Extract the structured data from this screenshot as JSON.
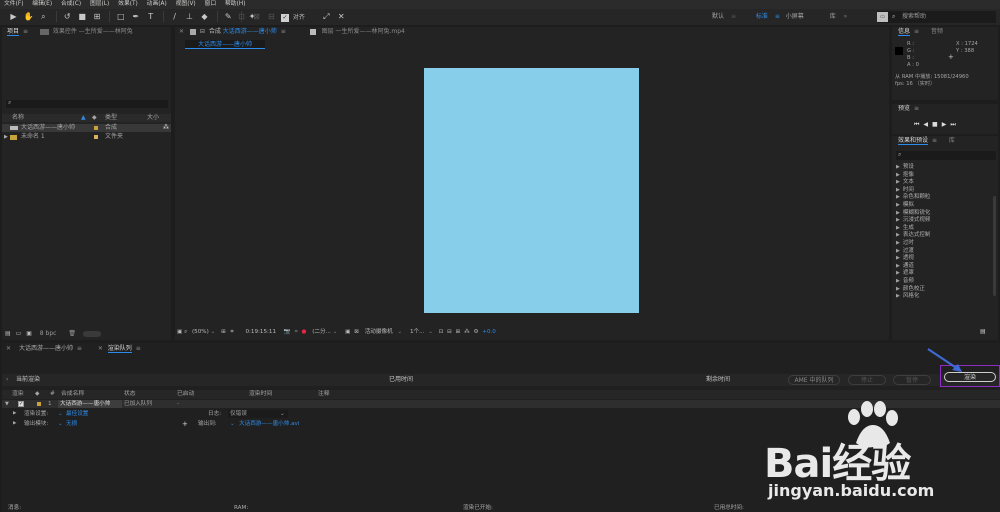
{
  "menu": [
    "文件(F)",
    "编辑(E)",
    "合成(C)",
    "图层(L)",
    "效果(T)",
    "动画(A)",
    "视图(V)",
    "窗口",
    "帮助(H)"
  ],
  "toolbar": {
    "snap_label": "对齐",
    "workspaces": [
      "默认",
      "标准",
      "小屏幕",
      "库"
    ],
    "active_workspace": "标准",
    "search_placeholder": "搜索帮助"
  },
  "project": {
    "tab_label": "项目",
    "effects_tab_label": "效果控件 —生所爱——林阿兔",
    "search_placeholder": "",
    "columns": [
      "名称",
      "类型",
      "大小"
    ],
    "items": [
      {
        "name": "大话西游——唐小帅",
        "type": "合成",
        "color": "#c9a23c"
      },
      {
        "name": "未命名 1",
        "type": "文件夹",
        "color": "#d7b25a"
      }
    ],
    "bpc": "8 bpc"
  },
  "composition": {
    "tab_label": "合成",
    "tab_name": "大话西游——唐小帅",
    "layer_tab_label": "图层 一生所爱——林阿兔.mp4",
    "sub_tab": "大话西游——唐小帅",
    "canvas_color": "#87ceeb",
    "zoom": "(50%)",
    "timecode": "0:19:15:11",
    "resolution": "(二分...",
    "camera": "活动摄像机",
    "views": "1个...",
    "exposure": "+0.0"
  },
  "info": {
    "tab_label": "信息",
    "audio_tab_label": "音频",
    "r": "R :",
    "g": "G :",
    "b": "B :",
    "a": "A :  0",
    "x": "X : 1724",
    "y": "Y : 388",
    "ram_line": "从 RAM 中播放: 15081/24960",
    "fps_line": "fps: 16 （实时）"
  },
  "preview": {
    "tab_label": "预览"
  },
  "effects": {
    "tab_label": "效果和预设",
    "tab2_label": "库",
    "items": [
      "预设",
      "抠像",
      "文本",
      "时间",
      "杂色和颗粒",
      "模拟",
      "模糊和锐化",
      "沉浸式视频",
      "生成",
      "表达式控制",
      "过时",
      "过渡",
      "透视",
      "通道",
      "遮罩",
      "音频",
      "颜色校正",
      "风格化"
    ]
  },
  "render_queue": {
    "tabs": [
      "大话西游——唐小帅",
      "渲染队列"
    ],
    "current_render_label": "当前渲染",
    "elapsed_label": "已用时间",
    "remaining_label": "剩余时间",
    "ame_button": "AME 中的队列",
    "stop_button": "停止",
    "pause_button": "暂停",
    "render_button": "渲染",
    "columns": [
      "渲染",
      "#",
      "合成名称",
      "状态",
      "已启动",
      "渲染时间",
      "注释"
    ],
    "row": {
      "index": "1",
      "comp": "大话西游——唐小帅",
      "status": "已加入队列",
      "started": "-"
    },
    "render_settings_label": "渲染设置:",
    "render_settings_value": "最佳设置",
    "log_label": "日志:",
    "log_value": "仅错误",
    "output_module_label": "输出模块:",
    "output_module_value": "无损",
    "output_to_label": "输出到:",
    "output_to_value": "大话西游——唐小帅.avi"
  },
  "status_bar": {
    "message": "消息:",
    "ram": "RAM:",
    "renders_started": "渲染已开始:",
    "total_time": "已用总时间:"
  },
  "watermark": {
    "brand": "Bai经验",
    "url": "jingyan.baidu.com"
  }
}
